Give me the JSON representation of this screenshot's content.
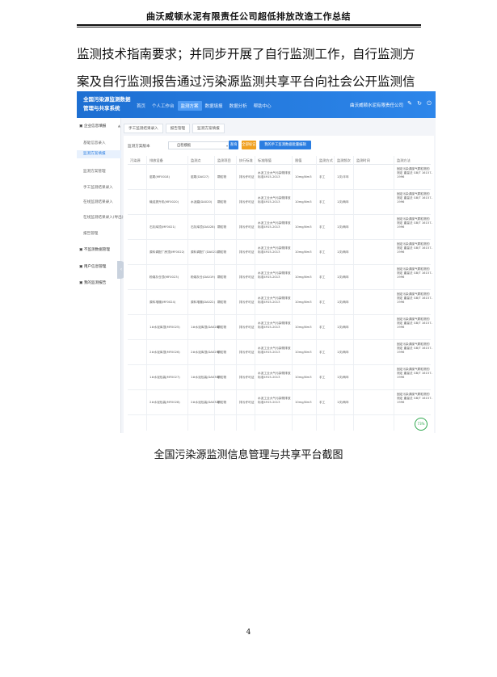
{
  "header": {
    "title": "曲沃威顿水泥有限责任公司超低排放改造工作总结"
  },
  "body": {
    "paragraph": "监测技术指南要求；并同步开展了自行监测工作，自行监测方案及自行监测报告通过污染源监测共享平台向社会公开监测信息。"
  },
  "screenshot": {
    "system_title": "全国污染源监测数据管理与共享系统",
    "top_nav": [
      "首页",
      "个人工作台",
      "监测方案",
      "数据填报",
      "数据分析",
      "帮助中心"
    ],
    "top_nav_active": 2,
    "company": "曲沃威顿水泥有限责任公司",
    "top_icons": [
      "edit-icon",
      "refresh-icon",
      "power-icon"
    ],
    "sidebar": [
      {
        "label": "企业信息填报",
        "kind": "group",
        "caret": "▲"
      },
      {
        "label": "基础信息录入",
        "kind": "sub"
      },
      {
        "label": "监测方案填报",
        "kind": "active"
      },
      {
        "label": "监测方案管理",
        "kind": "sub"
      },
      {
        "label": "手工监测结果录入",
        "kind": "sub"
      },
      {
        "label": "在线监测结果录入",
        "kind": "sub"
      },
      {
        "label": "在线监测结果录入(导出)",
        "kind": "sub"
      },
      {
        "label": "报告管理",
        "kind": "sub"
      },
      {
        "label": "不监测数据管理",
        "kind": "group"
      },
      {
        "label": "用户信息管理",
        "kind": "group",
        "caret": "▼"
      },
      {
        "label": "我的监测报告",
        "kind": "group"
      }
    ],
    "tabs": [
      "手工监测结果录入",
      "报告管理",
      "监测方案填报"
    ],
    "filter": {
      "label": "监测方案版本",
      "value": "自检模板"
    },
    "buttons": [
      {
        "label": "查询",
        "color": "#2a7de1"
      },
      {
        "label": "全部标记",
        "color": "#f0a020"
      },
      {
        "label": "我的手工监测数据批量编辑",
        "color": "#2a7de1"
      }
    ],
    "columns": [
      "污染源",
      "排放设备",
      "监测点",
      "监测项目",
      "执行标准",
      "标准限值",
      "限值",
      "监测方式",
      "监测频次",
      "监测时间",
      "监测方法"
    ],
    "rows": [
      {
        "device": "窑尾(MF0018)",
        "point": "窑尾(DA027)",
        "item": "颗粒物",
        "std": "排污许可证",
        "limit": "水泥工业大气污染物排放标准4915-2013",
        "value": "10mg/Nm3",
        "mode": "手工",
        "freq": "1次/半年",
        "method": "固定污染源废气颗粒物的测定 重量法 GB/T 16157-1996"
      },
      {
        "device": "输送提升机(MF0020)",
        "point": "水泥磨(DA020)",
        "item": "颗粒物",
        "std": "排污许可证",
        "limit": "水泥工业大气污染物排放标准4915-2013",
        "value": "10mg/Nm3",
        "mode": "手工",
        "freq": "1次/两年",
        "method": "固定污染源废气颗粒物的测定 重量法 GB/T 16157-1996"
      },
      {
        "device": "石灰库顶(MF0021)",
        "point": "石灰库顶(DA028)",
        "item": "颗粒物",
        "std": "排污许可证",
        "limit": "水泥工业大气污染物排放标准4915-2013",
        "value": "10mg/Nm3",
        "mode": "手工",
        "freq": "1次/两年",
        "method": "固定污染源废气颗粒物的测定 重量法 GB/T 16157-1996"
      },
      {
        "device": "原料调配厂房顶(MF0022)",
        "point": "原料调配厂(DA021)",
        "item": "颗粒物",
        "std": "排污许可证",
        "limit": "水泥工业大气污染物排放标准4915-2013",
        "value": "10mg/Nm3",
        "mode": "手工",
        "freq": "1次/两年",
        "method": "固定污染源废气颗粒物的测定 重量法 GB/T 16157-1996"
      },
      {
        "device": "粉煤灰仓顶(MF0023)",
        "point": "粉煤灰仓(DA019)",
        "item": "颗粒物",
        "std": "排污许可证",
        "limit": "水泥工业大气污染物排放标准4915-2013",
        "value": "10mg/Nm3",
        "mode": "手工",
        "freq": "1次/两年",
        "method": "固定污染源废气颗粒物的测定 重量法 GB/T 16157-1996"
      },
      {
        "device": "原料堆棚(MF0024)",
        "point": "原料堆棚(DA022)",
        "item": "颗粒物",
        "std": "排污许可证",
        "limit": "水泥工业大气污染物排放标准4915-2013",
        "value": "10mg/Nm3",
        "mode": "手工",
        "freq": "1次/两年",
        "method": "固定污染源废气颗粒物的测定 重量法 GB/T 16157-1996"
      },
      {
        "device": "1#水泥库顶(MF0025)",
        "point": "1#水泥库顶(DA028)",
        "item": "颗粒物",
        "std": "排污许可证",
        "limit": "水泥工业大气污染物排放标准4915-2013",
        "value": "10mg/Nm3",
        "mode": "手工",
        "freq": "1次/两年",
        "method": "固定污染源废气颗粒物的测定 重量法 GB/T 16157-1996"
      },
      {
        "device": "2#水泥库顶(MF0026)",
        "point": "2#水泥库顶(DA029)",
        "item": "颗粒物",
        "std": "排污许可证",
        "limit": "水泥工业大气污染物排放标准4915-2013",
        "value": "10mg/Nm3",
        "mode": "手工",
        "freq": "1次/两年",
        "method": "固定污染源废气颗粒物的测定 重量法 GB/T 16157-1996"
      },
      {
        "device": "1#水泥包装(MF0027)",
        "point": "1#水泥包装(DA030)",
        "item": "颗粒物",
        "std": "排污许可证",
        "limit": "水泥工业大气污染物排放标准4915-2013",
        "value": "10mg/Nm3",
        "mode": "手工",
        "freq": "1次/两年",
        "method": "固定污染源废气颗粒物的测定 重量法 GB/T 16157-1996"
      },
      {
        "device": "2#水泥包装(MF0028)",
        "point": "2#水泥包装(DA032)",
        "item": "颗粒物",
        "std": "排污许可证",
        "limit": "水泥工业大气污染物排放标准4915-2013",
        "value": "10mg/Nm3",
        "mode": "手工",
        "freq": "1次/两年",
        "method": "固定污染源废气颗粒物的测定 重量法 GB/T 16157-1996"
      }
    ],
    "progress_badge": "73%"
  },
  "caption": "全国污染源监测信息管理与共享平台截图",
  "page_number": "4"
}
